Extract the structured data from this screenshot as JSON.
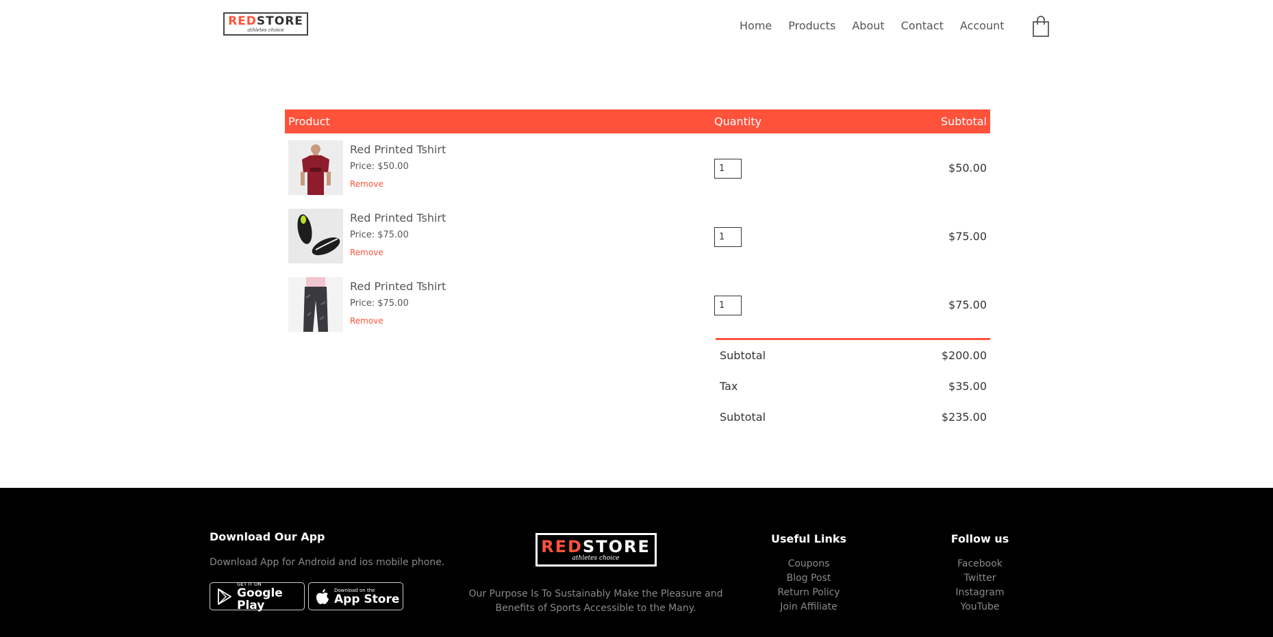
{
  "header": {
    "logo_part1": "RED",
    "logo_part2": "STORE",
    "logo_tagline": "athletes choice",
    "nav": [
      "Home",
      "Products",
      "About",
      "Contact",
      "Account"
    ]
  },
  "cart": {
    "headers": {
      "product": "Product",
      "quantity": "Quantity",
      "subtotal": "Subtotal"
    },
    "items": [
      {
        "name": "Red Printed Tshirt",
        "price": "Price: $50.00",
        "remove": "Remove",
        "quantity": "1",
        "subtotal": "$50.00",
        "image_icon": "red-tshirt-image"
      },
      {
        "name": "Red Printed Tshirt",
        "price": "Price: $75.00",
        "remove": "Remove",
        "quantity": "1",
        "subtotal": "$75.00",
        "image_icon": "black-shoes-image"
      },
      {
        "name": "Red Printed Tshirt",
        "price": "Price: $75.00",
        "remove": "Remove",
        "quantity": "1",
        "subtotal": "$75.00",
        "image_icon": "track-pants-image"
      }
    ],
    "totals": [
      {
        "label": "Subtotal",
        "value": "$200.00"
      },
      {
        "label": "Tax",
        "value": "$35.00"
      },
      {
        "label": "Subtotal",
        "value": "$235.00"
      }
    ]
  },
  "footer": {
    "download_title": "Download Our App",
    "download_text": "Download App for Android and ios mobile phone.",
    "google_play_small": "GET IT ON",
    "google_play_big": "Google Play",
    "app_store_small": "Download on the",
    "app_store_big": "App Store",
    "purpose_text": "Our Purpose Is To Sustainably Make the Pleasure and Benefits of Sports Accessible to the Many.",
    "useful_links_title": "Useful Links",
    "useful_links": [
      "Coupons",
      "Blog Post",
      "Return Policy",
      "Join Affiliate"
    ],
    "follow_title": "Follow us",
    "follow_links": [
      "Facebook",
      "Twitter",
      "Instagram",
      "YouTube"
    ]
  },
  "colors": {
    "accent": "#ff523b",
    "footer_bg": "#000000"
  }
}
